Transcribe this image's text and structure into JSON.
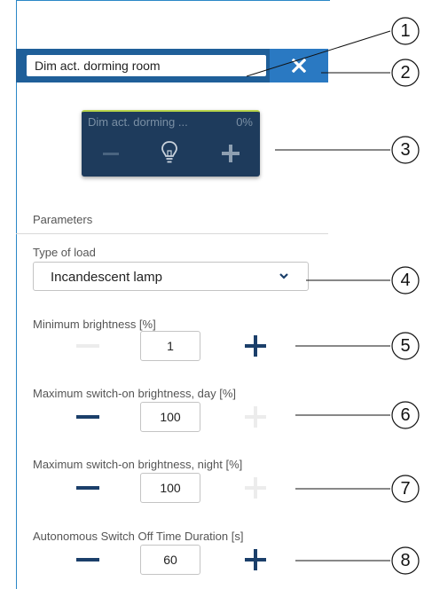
{
  "header": {
    "name_value": "Dim act. dorming room",
    "close_icon": "close-icon"
  },
  "tile": {
    "name": "Dim act. dorming ...",
    "percent": "0%",
    "minus_icon": "minus-icon",
    "bulb_icon": "light-bulb-icon",
    "plus_icon": "plus-icon",
    "accent_color": "#b7d34a",
    "background_color": "#1e3b5c"
  },
  "parameters": {
    "title": "Parameters",
    "type_of_load": {
      "label": "Type of load",
      "value": "Incandescent lamp",
      "chevron_icon": "chevron-down-icon"
    },
    "steppers": [
      {
        "label": "Minimum brightness [%]",
        "value": "1",
        "minus_enabled": false,
        "plus_enabled": true
      },
      {
        "label": "Maximum switch-on brightness, day [%]",
        "value": "100",
        "minus_enabled": true,
        "plus_enabled": false
      },
      {
        "label": "Maximum switch-on brightness, night [%]",
        "value": "100",
        "minus_enabled": true,
        "plus_enabled": false
      },
      {
        "label": "Autonomous Switch Off Time Duration [s]",
        "value": "60",
        "minus_enabled": true,
        "plus_enabled": true
      }
    ]
  },
  "callouts": [
    "1",
    "2",
    "3",
    "4",
    "5",
    "6",
    "7",
    "8"
  ],
  "colors": {
    "header_bar": "#1f5f99",
    "close_button": "#2a79c2",
    "stepper_icon": "#1b3f6a",
    "stepper_icon_disabled": "#ececec",
    "panel_border": "#2a87c7"
  }
}
